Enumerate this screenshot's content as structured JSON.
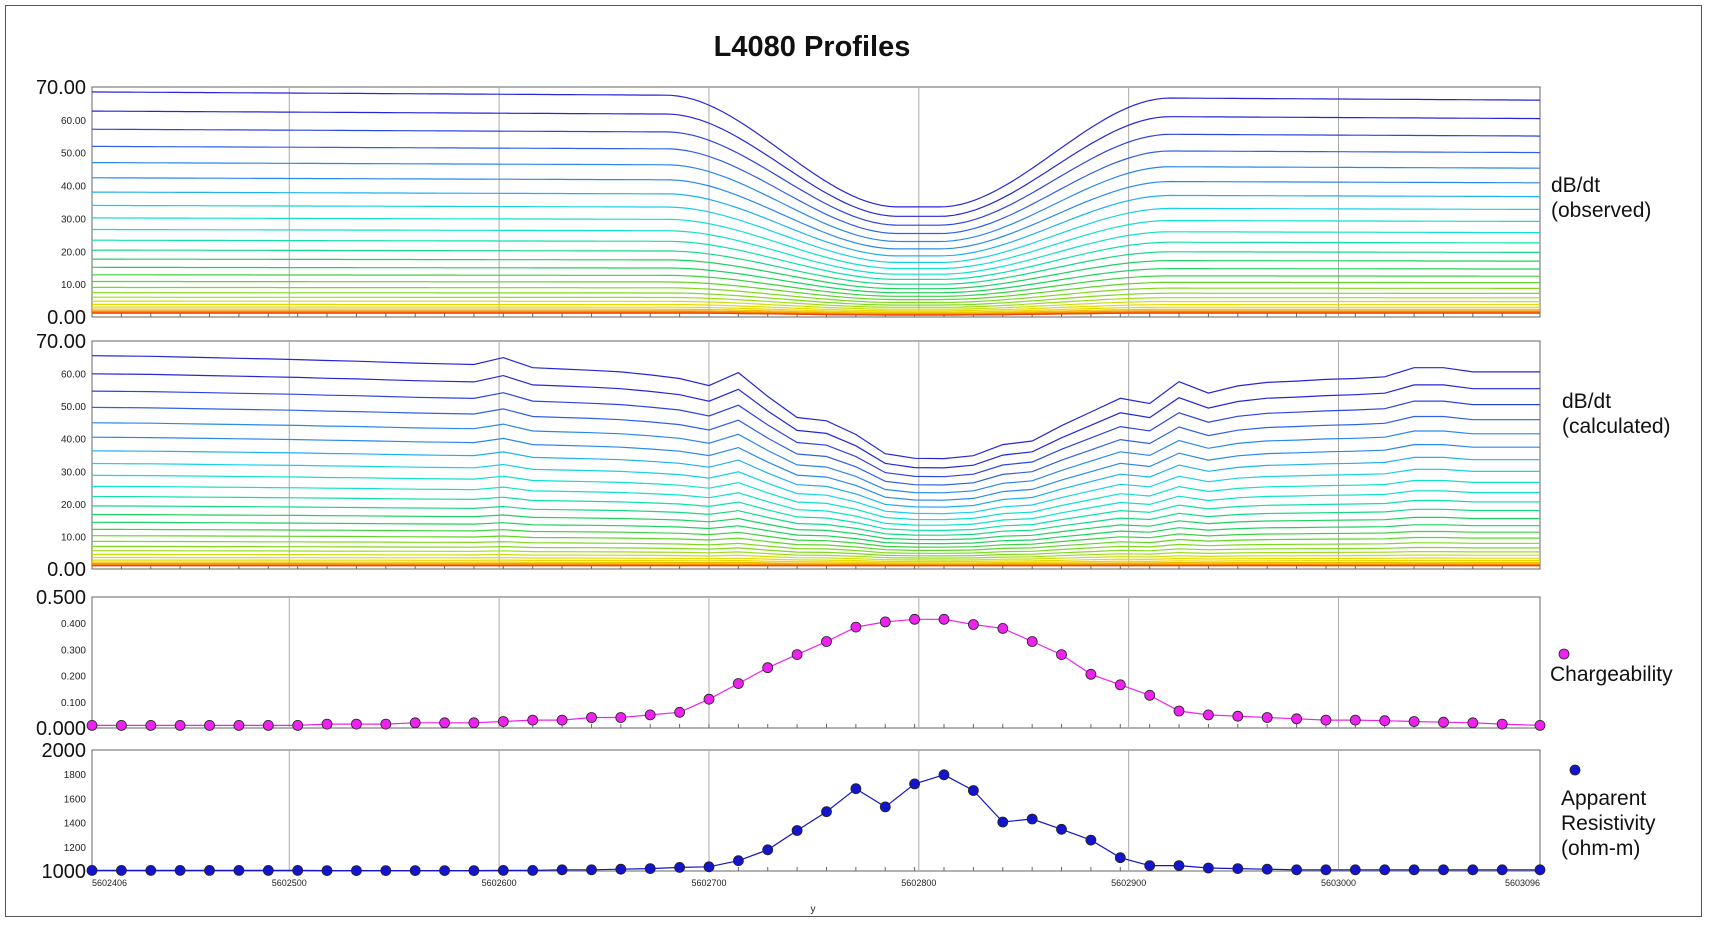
{
  "chart_data": {
    "title": "L4080 Profiles",
    "xlabel": "y",
    "x_range": [
      5602406,
      5603096
    ],
    "x_tick_labels": [
      "5602406",
      "5602500",
      "5602600",
      "5602700",
      "5602800",
      "5602900",
      "5603000",
      "5603096"
    ],
    "x_grid": [
      5602500,
      5602600,
      5602700,
      5602800,
      5602900,
      5603000
    ],
    "x_stations": [
      5602406,
      5602420,
      5602434,
      5602448,
      5602462,
      5602476,
      5602490,
      5602504,
      5602518,
      5602532,
      5602546,
      5602560,
      5602574,
      5602588,
      5602602,
      5602616,
      5602630,
      5602644,
      5602658,
      5602672,
      5602686,
      5602700,
      5602714,
      5602728,
      5602742,
      5602756,
      5602770,
      5602784,
      5602798,
      5602812,
      5602826,
      5602840,
      5602854,
      5602868,
      5602882,
      5602896,
      5602910,
      5602924,
      5602938,
      5602952,
      5602966,
      5602980,
      5602994,
      5603008,
      5603022,
      5603036,
      5603050,
      5603064,
      5603078,
      5603096
    ],
    "panels": [
      {
        "id": "observed",
        "type": "line",
        "legend_lines": [
          "dB/dt",
          "(observed)"
        ],
        "ylim": [
          0,
          70
        ],
        "y_major_labels": [
          "70.00",
          "0.00"
        ],
        "y_minor_labels": [
          "60.00",
          "50.00",
          "40.00",
          "30.00",
          "20.00",
          "10.00"
        ],
        "series_count": 28,
        "top_channel_baseline_start": 68.5,
        "top_channel_baseline_end": 66,
        "top_channel_anomaly_minimum": 33.5,
        "anomaly_center_x": 5602800,
        "colors": [
          "#2626d8",
          "#2c44e0",
          "#3060e6",
          "#2a88ea",
          "#20b0ee",
          "#18d0e8",
          "#10e0cc",
          "#10e0a8",
          "#18d884",
          "#20d060",
          "#40d040",
          "#60d428",
          "#80d820",
          "#a0dc18",
          "#c8e010",
          "#e8d800",
          "#f0c000",
          "#f4a000",
          "#f88000",
          "#f86010",
          "#f04010"
        ]
      },
      {
        "id": "calculated",
        "type": "line",
        "legend_lines": [
          "dB/dt",
          "(calculated)"
        ],
        "ylim": [
          0,
          70
        ],
        "y_major_labels": [
          "70.00",
          "0.00"
        ],
        "y_minor_labels": [
          "60.00",
          "50.00",
          "40.00",
          "30.00",
          "20.00",
          "10.00"
        ],
        "series_count": 28,
        "top_channel_values": [
          65.5,
          65.4,
          65.3,
          65.1,
          64.9,
          64.7,
          64.5,
          64.3,
          64.0,
          63.8,
          63.5,
          63.2,
          63.0,
          62.8,
          64.9,
          61.8,
          61.4,
          61.0,
          60.5,
          59.6,
          58.5,
          56.3,
          60.3,
          53.0,
          46.5,
          45.5,
          41.3,
          35.4,
          34.0,
          33.9,
          34.8,
          38.2,
          39.3,
          44.0,
          48.2,
          52.4,
          50.8,
          57.5,
          54.0,
          56.2,
          57.3,
          57.7,
          58.2,
          58.5,
          59.0,
          61.8,
          61.8,
          60.5,
          60.5,
          60.5
        ],
        "colors": [
          "#2626d8",
          "#2c44e0",
          "#3060e6",
          "#2a88ea",
          "#20b0ee",
          "#18d0e8",
          "#10e0cc",
          "#10e0a8",
          "#18d884",
          "#20d060",
          "#40d040",
          "#60d428",
          "#80d820",
          "#a0dc18",
          "#c8e010",
          "#e8d800",
          "#f0c000",
          "#f4a000",
          "#f88000",
          "#f86010",
          "#f04010"
        ]
      },
      {
        "id": "chargeability",
        "type": "scatter",
        "legend_lines": [
          "Chargeability"
        ],
        "ylim": [
          0,
          0.5
        ],
        "y_major_labels": [
          "0.500",
          "0.000"
        ],
        "y_minor_labels": [
          "0.400",
          "0.300",
          "0.200",
          "0.100"
        ],
        "color": "#ee22ee",
        "values": [
          0.01,
          0.01,
          0.01,
          0.01,
          0.01,
          0.01,
          0.01,
          0.01,
          0.015,
          0.015,
          0.015,
          0.02,
          0.02,
          0.02,
          0.025,
          0.03,
          0.03,
          0.04,
          0.04,
          0.05,
          0.06,
          0.11,
          0.17,
          0.23,
          0.28,
          0.33,
          0.385,
          0.405,
          0.415,
          0.415,
          0.395,
          0.38,
          0.33,
          0.28,
          0.205,
          0.165,
          0.125,
          0.065,
          0.05,
          0.045,
          0.04,
          0.035,
          0.03,
          0.03,
          0.028,
          0.025,
          0.022,
          0.02,
          0.015,
          0.01
        ]
      },
      {
        "id": "resistivity",
        "type": "scatter",
        "legend_lines": [
          "Apparent",
          "Resistivity",
          "(ohm-m)"
        ],
        "ylim": [
          1000,
          2000
        ],
        "y_major_labels": [
          "2000",
          "1000"
        ],
        "y_minor_labels": [
          "1800",
          "1600",
          "1400",
          "1200"
        ],
        "color": "#1414cc",
        "values": [
          1005,
          1005,
          1005,
          1005,
          1005,
          1005,
          1005,
          1005,
          1003,
          1003,
          1003,
          1003,
          1003,
          1003,
          1005,
          1005,
          1010,
          1010,
          1015,
          1020,
          1030,
          1035,
          1085,
          1175,
          1335,
          1490,
          1680,
          1530,
          1720,
          1795,
          1665,
          1405,
          1430,
          1345,
          1255,
          1110,
          1045,
          1045,
          1025,
          1020,
          1015,
          1010,
          1010,
          1010,
          1010,
          1010,
          1010,
          1010,
          1010,
          1010
        ]
      }
    ]
  }
}
